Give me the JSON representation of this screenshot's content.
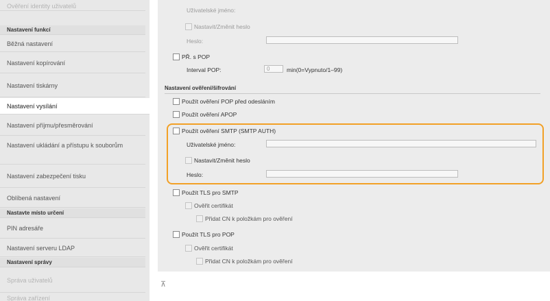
{
  "sidebar": {
    "items": [
      {
        "label": "Ověření identity uživatelů",
        "kind": "faded"
      },
      {
        "label": "Nastavení funkcí",
        "kind": "section"
      },
      {
        "label": "Běžná nastavení",
        "kind": "item"
      },
      {
        "label": "Nastavení kopírování",
        "kind": "item"
      },
      {
        "label": "Nastavení tiskárny",
        "kind": "item"
      },
      {
        "label": "Nastavení vysílání",
        "kind": "active"
      },
      {
        "label": "Nastavení příjmu/přesměrování",
        "kind": "item"
      },
      {
        "label": "Nastavení ukládání a přístupu k souborům",
        "kind": "item"
      },
      {
        "label": "Nastavení zabezpečení tisku",
        "kind": "item"
      },
      {
        "label": "Oblíbená nastavení",
        "kind": "item"
      },
      {
        "label": "Nastavte místo určení",
        "kind": "section"
      },
      {
        "label": "PIN adresáře",
        "kind": "item"
      },
      {
        "label": "Nastavení serveru LDAP",
        "kind": "item"
      },
      {
        "label": "Nastavení správy",
        "kind": "section"
      },
      {
        "label": "Správa uživatelů",
        "kind": "faded"
      },
      {
        "label": "Správa zařízení",
        "kind": "faded"
      }
    ]
  },
  "main": {
    "top_username_label": "Uživatelské jméno:",
    "top_set_password_label": "Nastavit/Změnit heslo",
    "top_password_label": "Heslo:",
    "pop_checkbox_label": "PŘ. s POP",
    "pop_interval_label": "Interval POP:",
    "pop_interval_value": "0",
    "pop_interval_unit": "min(0=Vypnuto/1–99)",
    "auth_section_label": "Nastavení ověření/šifrování",
    "auth_pop_before_send": "Použít ověření POP před odesláním",
    "auth_apop": "Použít ověření APOP",
    "smtp_auth_label": "Použít ověření SMTP (SMTP AUTH)",
    "smtp_username_label": "Uživatelské jméno:",
    "smtp_set_password_label": "Nastavit/Změnit heslo",
    "smtp_password_label": "Heslo:",
    "tls_smtp_label": "Použít TLS pro SMTP",
    "tls_smtp_verify_cert": "Ověřit certifikát",
    "tls_smtp_add_cn": "Přidat CN k položkám pro ověření",
    "tls_pop_label": "Použít TLS pro POP",
    "tls_pop_verify_cert": "Ověřit certifikát",
    "tls_pop_add_cn": "Přidat CN k položkám pro ověření"
  },
  "footer": {
    "scroll_top_icon": "⊼"
  },
  "colors": {
    "highlight": "#f2a025",
    "sidebar_bg": "#e8e8e8",
    "panel_bg": "#ececec"
  }
}
